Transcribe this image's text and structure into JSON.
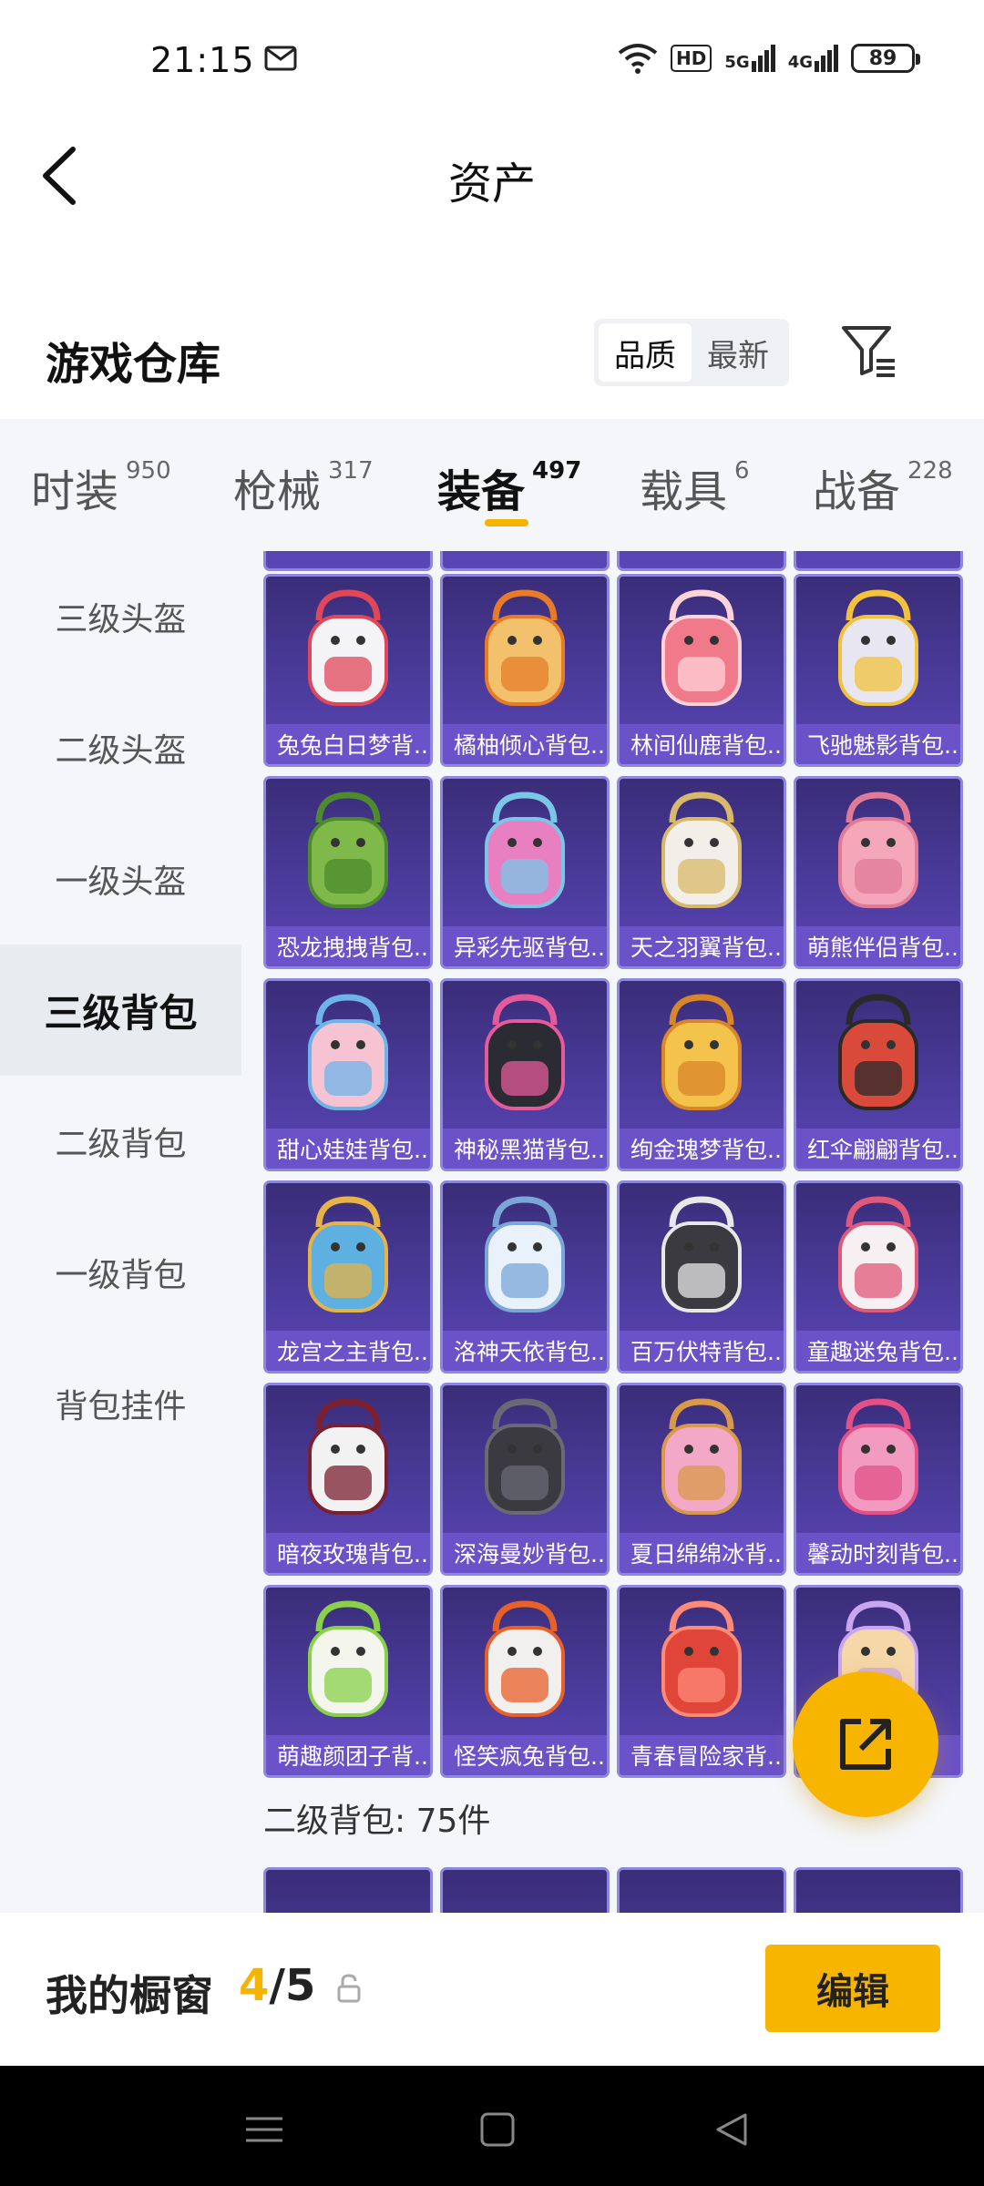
{
  "status": {
    "time": "21:15",
    "battery": "89",
    "signal_5g": "5G",
    "signal_4g": "4G",
    "hd": "HD"
  },
  "header": {
    "title": "资产"
  },
  "warehouse": {
    "title": "游戏仓库",
    "sort_options": [
      "品质",
      "最新"
    ],
    "active_sort": "品质"
  },
  "tabs": [
    {
      "label": "时装",
      "count": "950"
    },
    {
      "label": "枪械",
      "count": "317"
    },
    {
      "label": "装备",
      "count": "497"
    },
    {
      "label": "载具",
      "count": "6"
    },
    {
      "label": "战备",
      "count": "228"
    }
  ],
  "sidebar": [
    "三级头盔",
    "二级头盔",
    "一级头盔",
    "三级背包",
    "二级背包",
    "一级背包",
    "背包挂件"
  ],
  "items": [
    "兔兔白日梦背...",
    "橘柚倾心背包...",
    "林间仙鹿背包...",
    "飞驰魅影背包...",
    "恐龙拽拽背包...",
    "异彩先驱背包...",
    "天之羽翼背包...",
    "萌熊伴侣背包...",
    "甜心娃娃背包...",
    "神秘黑猫背包...",
    "绚金瑰梦背包...",
    "红伞翩翩背包...",
    "龙宫之主背包...",
    "洛神天依背包...",
    "百万伏特背包...",
    "童趣迷兔背包...",
    "暗夜玫瑰背包...",
    "深海曼妙背包...",
    "夏日绵绵冰背...",
    "馨动时刻背包...",
    "萌趣颜团子背...",
    "怪笑疯兔背包...",
    "青春冒险家背...",
    "..."
  ],
  "section": {
    "label": "二级背包: 75件"
  },
  "showcase": {
    "label": "我的橱窗",
    "current": "4",
    "separator": "/",
    "total": "5",
    "edit_label": "编辑"
  },
  "colors": {
    "accent": "#f7b500",
    "card_bg": "#4b3b9b",
    "card_label": "#6a52c8"
  }
}
